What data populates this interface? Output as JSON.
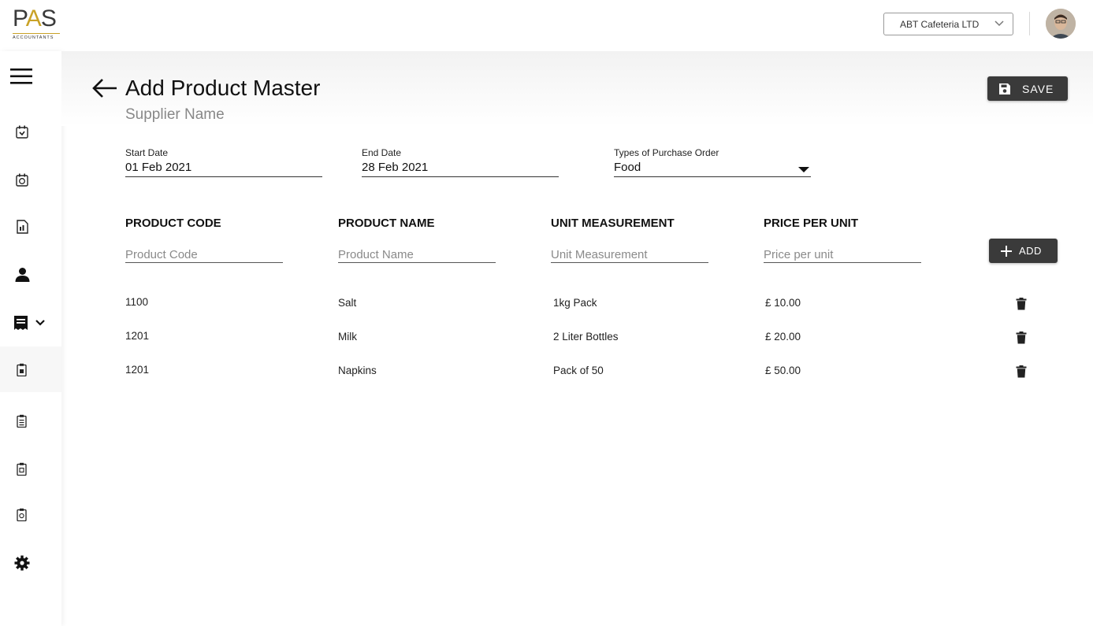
{
  "header": {
    "logo_text": "PAS",
    "logo_subtext": "ACCOUNTANTS",
    "company_select": "ABT Cafeteria LTD"
  },
  "sidebar": {
    "items": [
      {
        "icon": "menu-icon"
      },
      {
        "icon": "calendar-icon"
      },
      {
        "icon": "calendar-clock-icon"
      },
      {
        "icon": "document-icon"
      },
      {
        "icon": "user-icon"
      },
      {
        "icon": "receipt-icon"
      },
      {
        "icon": "clipboard-icon"
      },
      {
        "icon": "clipboard-list-icon"
      },
      {
        "icon": "clipboard-check-icon"
      },
      {
        "icon": "clipboard-star-icon"
      },
      {
        "icon": "gear-icon"
      }
    ]
  },
  "page": {
    "title": "Add Product Master",
    "subtitle": "Supplier Name",
    "save_label": "SAVE"
  },
  "form": {
    "start_date": {
      "label": "Start Date",
      "value": "01 Feb 2021"
    },
    "end_date": {
      "label": "End Date",
      "value": "28 Feb 2021"
    },
    "po_type": {
      "label": "Types of Purchase Order",
      "value": "Food"
    }
  },
  "table": {
    "columns": [
      "PRODUCT CODE",
      "PRODUCT NAME",
      "UNIT MEASUREMENT",
      "PRICE PER UNIT"
    ],
    "placeholders": [
      "Product Code",
      "Product Name",
      "Unit Measurement",
      "Price per unit"
    ],
    "add_label": "ADD",
    "rows": [
      {
        "code": "1100",
        "name": "Salt",
        "unit": "1kg Pack",
        "price": "£ 10.00"
      },
      {
        "code": "1201",
        "name": "Milk",
        "unit": "2 Liter Bottles",
        "price": "£ 20.00"
      },
      {
        "code": "1201",
        "name": "Napkins",
        "unit": "Pack of 50",
        "price": "£ 50.00"
      }
    ]
  }
}
